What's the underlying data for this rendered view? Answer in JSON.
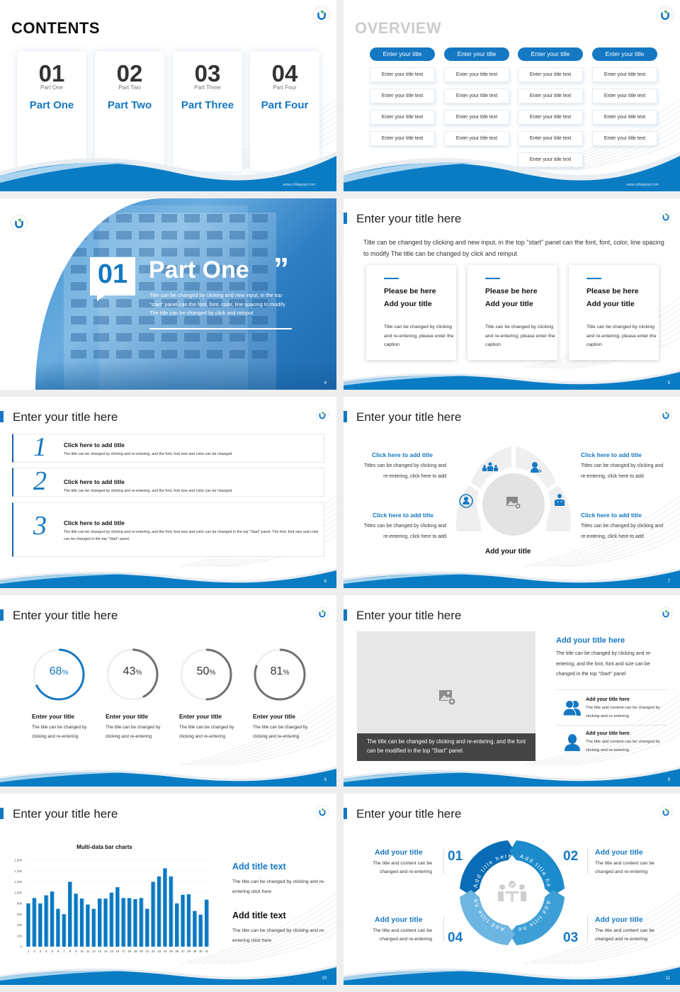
{
  "brand": {
    "accent": "#1578c2",
    "dark_accent": "#0a66b0",
    "light_wave": "#a9d3ee",
    "footer_url": "www.collegeppt.com"
  },
  "slide1": {
    "title": "CONTENTS",
    "items": [
      {
        "num": "01",
        "sub": "Part One",
        "label": "Part One"
      },
      {
        "num": "02",
        "sub": "Part Two",
        "label": "Part Two"
      },
      {
        "num": "03",
        "sub": "Part Three",
        "label": "Part Three"
      },
      {
        "num": "04",
        "sub": "Part Four",
        "label": "Part Four"
      }
    ]
  },
  "slide2": {
    "title": "OVERVIEW",
    "columns": [
      {
        "head": "Enter your title",
        "items": [
          "Enter your title text",
          "Enter your title text",
          "Enter your title text",
          "Enter your title text"
        ]
      },
      {
        "head": "Enter your title",
        "items": [
          "Enter your title text",
          "Enter your title text",
          "Enter your title text",
          "Enter your title text"
        ]
      },
      {
        "head": "Enter your title",
        "items": [
          "Enter your title text",
          "Enter your title text",
          "Enter your title text",
          "Enter your title text",
          "Enter your title text"
        ]
      },
      {
        "head": "Enter your title",
        "items": [
          "Enter your title text",
          "Enter your title text",
          "Enter your title text",
          "Enter your title text"
        ]
      }
    ]
  },
  "slide3": {
    "num": "01",
    "title": "Part One",
    "quote": "”",
    "text": "Title can be changed by clicking and new input, in the top \"start\" panel can the font, font, color, line spacing to modify The title can be changed by click and reinput",
    "page": "4"
  },
  "slide4": {
    "title": "Enter your title here",
    "intro": "Title can be changed by clicking and new input, in the top \"start\" panel can the font, font, color, line spacing to modify The title can be changed by click and reinput",
    "cards": [
      {
        "line1": "Please be here",
        "line2": "Add your title",
        "body": "Title can be changed by clicking and re-entering, please enter the caption"
      },
      {
        "line1": "Please be here",
        "line2": "Add your title",
        "body": "Title can be changed by clicking and re-entering, please enter the caption"
      },
      {
        "line1": "Please be here",
        "line2": "Add your title",
        "body": "Title can be changed by clicking and re-entering, please enter the caption"
      }
    ],
    "page": "5"
  },
  "slide5": {
    "title": "Enter your title here",
    "rows": [
      {
        "num": "1",
        "head": "Click here to add title",
        "body": "The title can be changed by clicking and re-entering, and the font, font size and color can be changed"
      },
      {
        "num": "2",
        "head": "Click here to add title",
        "body": "The title can be changed by clicking and re-entering, and the font, font size and color can be changed"
      },
      {
        "num": "3",
        "head": "Click here to add title",
        "body": "The title can be changed by clicking and re-entering, and the font, font size and color can be changed in the top \"Start\" panel. The font, font size and color can be changed in the top \"Start\" panel."
      }
    ],
    "page": "6"
  },
  "slide6": {
    "title": "Enter your title here",
    "blocks": [
      {
        "head": "Click here to add title",
        "body": "Titles can be changed by clicking and re-entering, click here to add"
      },
      {
        "head": "Click here to add title",
        "body": "Titles can be changed by clicking and re-entering, click here to add"
      },
      {
        "head": "Click here to add title",
        "body": "Titles can be changed by clicking and re-entering, click here to add"
      },
      {
        "head": "Click here to add title",
        "body": "Titles can be changed by clicking and re-entering, click here to add"
      }
    ],
    "icons": [
      "user-circle-icon",
      "team-icon",
      "support-agent-icon",
      "reader-icon"
    ],
    "center_icon": "image-add-icon",
    "caption": "Add your title",
    "page": "7"
  },
  "slide7": {
    "title": "Enter your title here",
    "gauges": [
      {
        "value": 68,
        "label": "68",
        "unit": "%",
        "color": "#1578c2",
        "head": "Enter your title",
        "body": "The title can be changed by clicking and re-entering"
      },
      {
        "value": 43,
        "label": "43",
        "unit": "%",
        "color": "#707070",
        "head": "Enter your title",
        "body": "The title can be changed by clicking and re-entering"
      },
      {
        "value": 50,
        "label": "50",
        "unit": "%",
        "color": "#707070",
        "head": "Enter your title",
        "body": "The title can be changed by clicking and re-entering"
      },
      {
        "value": 81,
        "label": "81",
        "unit": "%",
        "color": "#707070",
        "head": "Enter your title",
        "body": "The title can be changed by clicking and re-entering"
      }
    ],
    "page": "8"
  },
  "slide8": {
    "title": "Enter your title here",
    "photo_caption": "The title can be changed by clicking and re-entering, and the font can be modified in the top \"Start\" panel.",
    "head": "Add your title here",
    "text": "The title can be changed by clicking and re-entering, and the font, font and size can be changed in the top \"Start\" panel",
    "items": [
      {
        "icon": "users-icon",
        "head": "Add your title here",
        "body": "The title and content can be changed by clicking and re-entering"
      },
      {
        "icon": "user-icon",
        "head": "Add your title here",
        "body": "The title and content can be changed by clicking and re-entering"
      }
    ],
    "page": "9"
  },
  "slide9": {
    "title": "Enter your title here",
    "side": [
      {
        "head": "Add title text",
        "body": "The title can be changed by clicking and re-entering click here"
      },
      {
        "head": "Add title text",
        "body": "The title can be changed by clicking and re-entering click here"
      }
    ],
    "page": "10"
  },
  "chart_data": {
    "type": "bar",
    "title": "Multi-data bar charts",
    "xlabel": "",
    "ylabel": "",
    "categories": [
      "1",
      "2",
      "3",
      "4",
      "5",
      "6",
      "7",
      "8",
      "9",
      "10",
      "11",
      "12",
      "13",
      "14",
      "15",
      "16",
      "17",
      "18",
      "19",
      "20",
      "21",
      "22",
      "23",
      "24",
      "25",
      "26",
      "27",
      "28",
      "29",
      "30",
      "31"
    ],
    "values": [
      800,
      900,
      800,
      950,
      1020,
      700,
      600,
      1200,
      980,
      890,
      780,
      700,
      890,
      890,
      1000,
      1100,
      900,
      900,
      880,
      900,
      700,
      1200,
      1300,
      1450,
      1300,
      800,
      960,
      970,
      660,
      590,
      870
    ],
    "ylim": [
      0,
      1600
    ],
    "yticks": [
      0,
      200,
      400,
      600,
      800,
      1000,
      1200,
      1400,
      1600
    ],
    "ytick_labels": [
      "0",
      "200",
      "400",
      "600",
      "800",
      "1,000",
      "1,200",
      "1,400",
      "1,600"
    ],
    "grid": true,
    "color": "#0a78c2"
  },
  "slide10": {
    "title": "Enter your title here",
    "steps": [
      {
        "num": "01",
        "head": "Add your title",
        "body": "The title and content can be changed and re-entering",
        "arc": "Add title here"
      },
      {
        "num": "02",
        "head": "Add your title",
        "body": "The title and content can be changed and re-entering",
        "arc": "Add title here"
      },
      {
        "num": "03",
        "head": "Add your title",
        "body": "The title and content can be changed and re-entering",
        "arc": "Add title here"
      },
      {
        "num": "04",
        "head": "Add your title",
        "body": "The title and content can be changed and re-entering",
        "arc": "Add title here"
      }
    ],
    "center_icon": "meeting-approve-icon",
    "page": "11"
  }
}
